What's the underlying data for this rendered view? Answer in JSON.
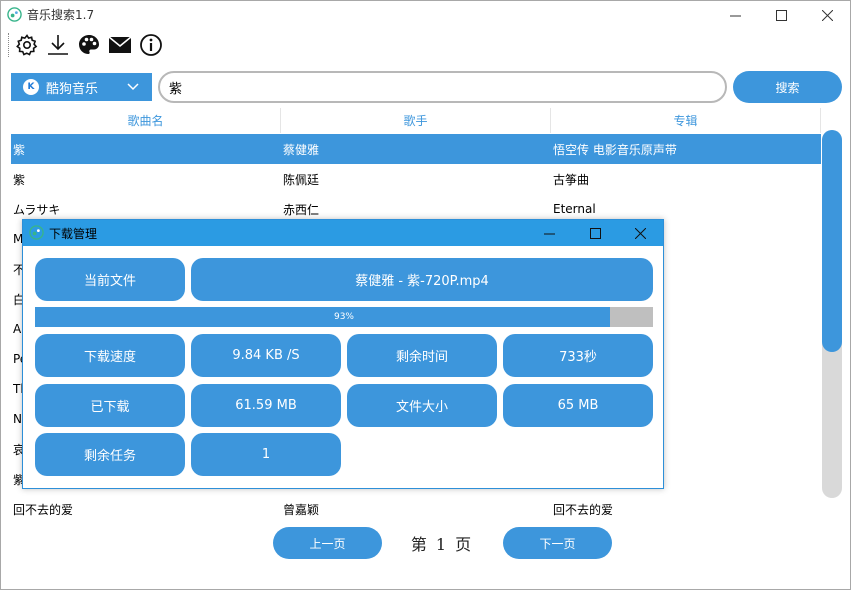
{
  "window": {
    "title": "音乐搜索1.7"
  },
  "toolbar": {
    "icons": [
      "gear-icon",
      "download-icon",
      "palette-icon",
      "mail-icon",
      "info-icon"
    ]
  },
  "search": {
    "source": "酷狗音乐",
    "source_logo": "K",
    "query": "紫",
    "button": "搜索"
  },
  "table": {
    "headers": [
      "歌曲名",
      "歌手",
      "专辑"
    ],
    "rows": [
      {
        "title": "紫",
        "artist": "蔡健雅",
        "album": "悟空传 电影音乐原声带"
      },
      {
        "title": "紫",
        "artist": "陈佩廷",
        "album": "古筝曲"
      },
      {
        "title": "ムラサキ",
        "artist": "赤西仁",
        "album": "Eternal"
      },
      {
        "title": "M",
        "artist": "",
        "album": ""
      },
      {
        "title": "不",
        "artist": "",
        "album": ""
      },
      {
        "title": "白",
        "artist": "",
        "album": ""
      },
      {
        "title": "A",
        "artist": "",
        "album": ""
      },
      {
        "title": "Pe",
        "artist": "",
        "album": ""
      },
      {
        "title": "Th",
        "artist": "",
        "album": ""
      },
      {
        "title": "N",
        "artist": "",
        "album": ""
      },
      {
        "title": "哀",
        "artist": "",
        "album": ""
      },
      {
        "title": "紫",
        "artist": "",
        "album": ""
      },
      {
        "title": "回不去的爱",
        "artist": "曾嘉颖",
        "album": "回不去的爱"
      }
    ],
    "selected_index": 0
  },
  "pager": {
    "prev": "上一页",
    "page": "第 1 页",
    "next": "下一页"
  },
  "dialog": {
    "title": "下载管理",
    "current_file_label": "当前文件",
    "current_file": "蔡健雅 - 紫-720P.mp4",
    "progress_percent": 93,
    "progress_text": "93%",
    "speed_label": "下载速度",
    "speed": "9.84 KB /S",
    "remaining_time_label": "剩余时间",
    "remaining_time": "733秒",
    "downloaded_label": "已下载",
    "downloaded": "61.59 MB",
    "file_size_label": "文件大小",
    "file_size": "65 MB",
    "remaining_tasks_label": "剩余任务",
    "remaining_tasks": "1"
  },
  "colors": {
    "accent": "#3d96dc",
    "dialog_title": "#2b9be3",
    "track": "#d9d9d9"
  }
}
